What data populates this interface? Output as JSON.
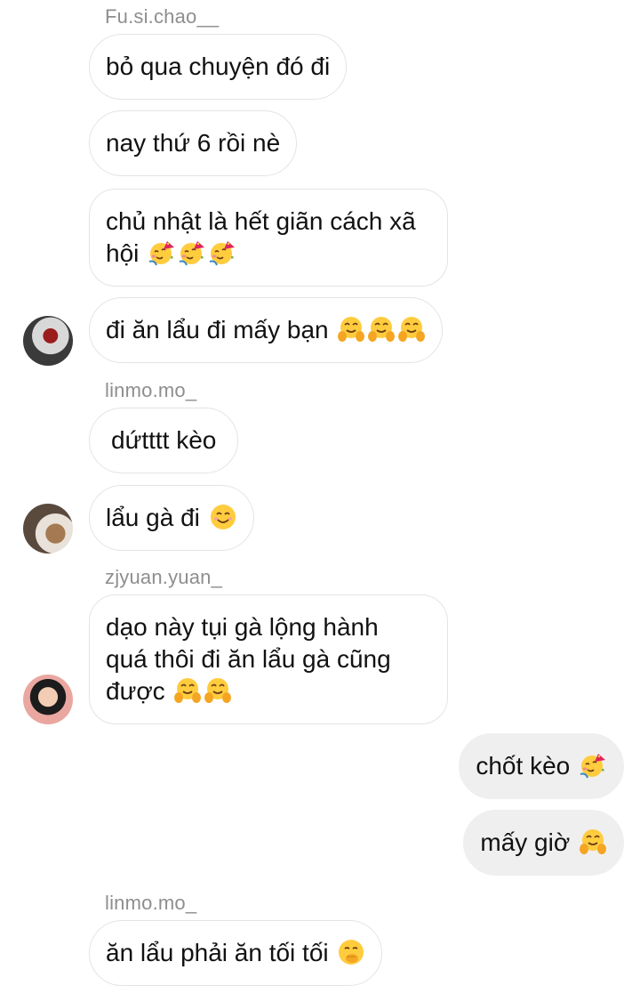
{
  "messages": [
    {
      "sender": "Fu.si.chao__",
      "text1": "bỏ qua chuyện đó đi"
    },
    {
      "text1": "nay thứ 6 rồi nè"
    },
    {
      "text1": "chủ nhật là hết giãn cách xã",
      "text2": "hội",
      "emoji": [
        "partying-face-emoji",
        "partying-face-emoji",
        "partying-face-emoji"
      ]
    },
    {
      "text1": "đi ăn lẩu đi mấy bạn",
      "emoji": [
        "hugging-face-emoji",
        "hugging-face-emoji",
        "hugging-face-emoji"
      ]
    },
    {
      "sender": "linmo.mo_",
      "text1": "dứtttt kèo"
    },
    {
      "text1": "lẩu gà đi",
      "emoji": [
        "smiling-face-emoji"
      ]
    },
    {
      "sender": "zjyuan.yuan_",
      "text1": "dạo này tụi gà lộng hành",
      "text2": "quá thôi đi ăn lẩu gà cũng",
      "text3": "được",
      "emoji": [
        "hugging-face-emoji",
        "hugging-face-emoji"
      ]
    },
    {
      "text1": "chốt kèo",
      "emoji": [
        "partying-face-emoji"
      ],
      "own": true
    },
    {
      "text1": "mấy giờ",
      "emoji": [
        "hugging-face-emoji"
      ],
      "own": true
    },
    {
      "sender": "linmo.mo_",
      "text1": "ăn lẩu phải ăn tối tối",
      "emoji": [
        "face-with-hand-over-mouth-emoji"
      ]
    }
  ],
  "colors": {
    "bubble_border": "#e4e4e4",
    "own_bubble": "#efefef",
    "sender": "#8e8e8e"
  }
}
